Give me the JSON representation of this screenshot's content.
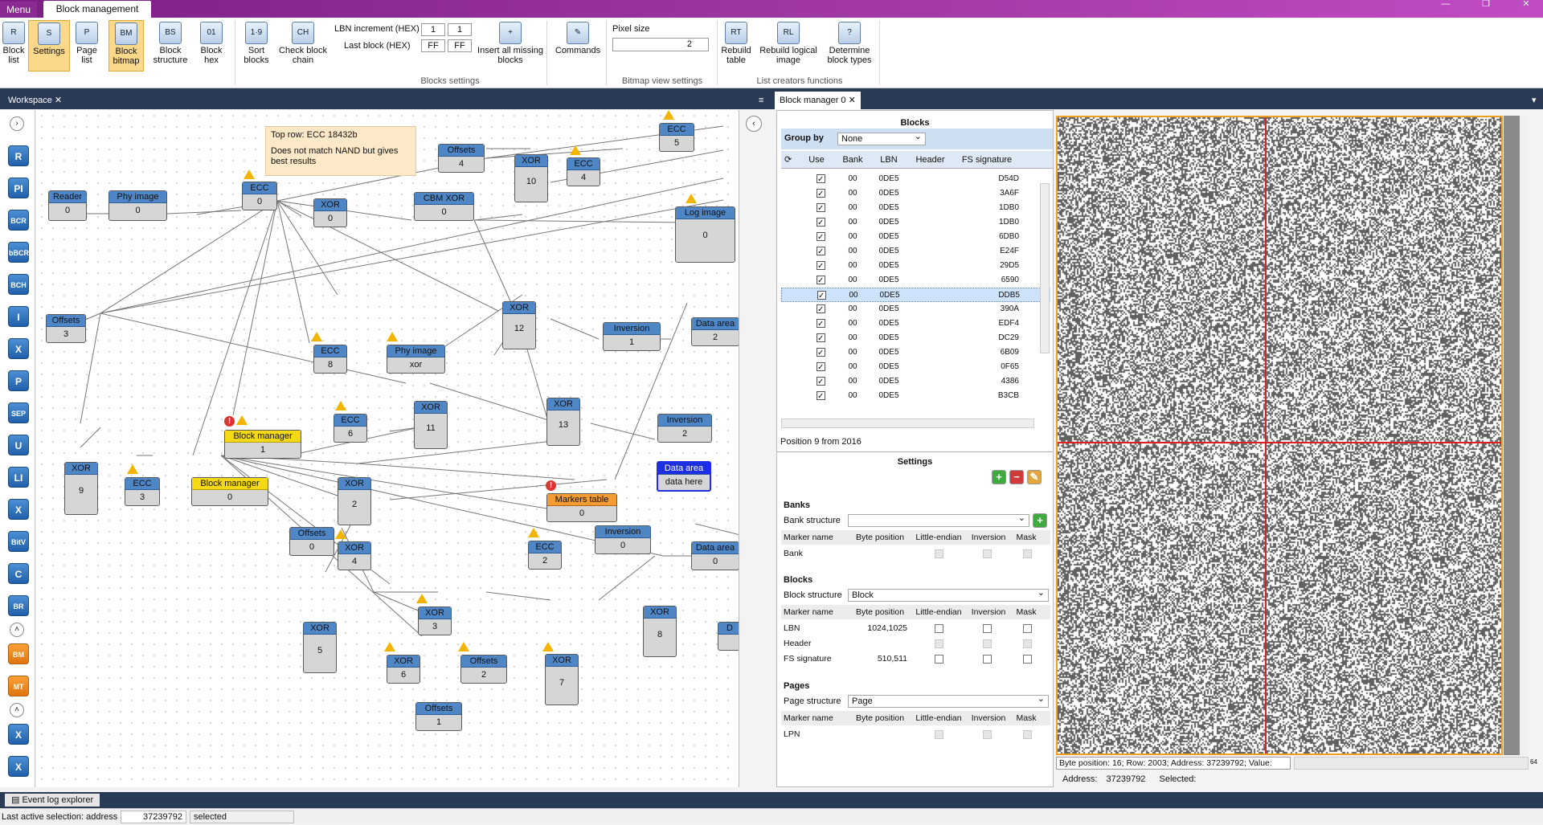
{
  "window": {
    "menu_label": "Menu",
    "active_tab": "Block management"
  },
  "ribbon": {
    "buttons": [
      {
        "label": "Block list",
        "icon": "R"
      },
      {
        "label": "Settings",
        "icon": "S"
      },
      {
        "label": "Page list",
        "icon": "P"
      },
      {
        "label": "Block bitmap",
        "icon": "BM"
      },
      {
        "label": "Block structure",
        "icon": "BS"
      },
      {
        "label": "Block hex",
        "icon": "01"
      },
      {
        "label": "Sort blocks",
        "icon": "1·9"
      },
      {
        "label": "Check block chain",
        "icon": "CH"
      },
      {
        "label": "Insert all missing blocks",
        "icon": "+"
      },
      {
        "label": "Commands",
        "icon": "✎"
      },
      {
        "label": "Rebuild table",
        "icon": "RT"
      },
      {
        "label": "Rebuild logical image",
        "icon": "RL"
      },
      {
        "label": "Determine block types",
        "icon": "?"
      }
    ],
    "lbn_increment_label": "LBN increment (HEX)",
    "lbn_increment": [
      "1",
      "1"
    ],
    "last_block_label": "Last block (HEX)",
    "last_block": [
      "FF",
      "FF"
    ],
    "pixel_size_label": "Pixel size",
    "pixel_size": "2",
    "groups": [
      "Blocks settings",
      "Bitmap view settings",
      "List creators functions"
    ]
  },
  "docbar": {
    "workspace_tab": "Workspace",
    "manager_tab": "Block manager 0"
  },
  "left_tools": [
    "R",
    "PI",
    "BCR",
    "bBCR",
    "BCH",
    "I",
    "X",
    "P",
    "SEP",
    "U",
    "LI",
    "X",
    "BitV",
    "C",
    "BR",
    "BM",
    "MT",
    "X",
    "X"
  ],
  "canvas": {
    "note": {
      "line1": "Top row: ECC 18432b",
      "line2": "Does not match NAND but gives best results"
    },
    "nodes": [
      {
        "title": "Reader",
        "value": "0"
      },
      {
        "title": "Phy image",
        "value": "0"
      },
      {
        "title": "ECC",
        "value": "0"
      },
      {
        "title": "XOR",
        "value": "0"
      },
      {
        "title": "CBM XOR",
        "value": "0"
      },
      {
        "title": "Offsets",
        "value": "4"
      },
      {
        "title": "XOR",
        "value": "10"
      },
      {
        "title": "ECC",
        "value": "4"
      },
      {
        "title": "ECC",
        "value": "5"
      },
      {
        "title": "Log image",
        "value": "0"
      },
      {
        "title": "Offsets",
        "value": "3"
      },
      {
        "title": "ECC",
        "value": "8"
      },
      {
        "title": "Phy image",
        "value": "xor"
      },
      {
        "title": "XOR",
        "value": "12"
      },
      {
        "title": "Inversion",
        "value": "1"
      },
      {
        "title": "Data area",
        "value": "2"
      },
      {
        "title": "ECC",
        "value": "6"
      },
      {
        "title": "XOR",
        "value": "11"
      },
      {
        "title": "XOR",
        "value": "13"
      },
      {
        "title": "Inversion",
        "value": "2"
      },
      {
        "title": "Block manager",
        "value": "1"
      },
      {
        "title": "XOR",
        "value": "9"
      },
      {
        "title": "ECC",
        "value": "3"
      },
      {
        "title": "Block manager",
        "value": "0"
      },
      {
        "title": "XOR",
        "value": "2"
      },
      {
        "title": "Markers table",
        "value": "0"
      },
      {
        "title": "Data area",
        "value": "data here"
      },
      {
        "title": "Offsets",
        "value": "0"
      },
      {
        "title": "XOR",
        "value": "4"
      },
      {
        "title": "ECC",
        "value": "2"
      },
      {
        "title": "Inversion",
        "value": "0"
      },
      {
        "title": "Data area",
        "value": "0"
      },
      {
        "title": "XOR",
        "value": "3"
      },
      {
        "title": "XOR",
        "value": "8"
      },
      {
        "title": "D",
        "value": ""
      },
      {
        "title": "XOR",
        "value": "5"
      },
      {
        "title": "XOR",
        "value": "6"
      },
      {
        "title": "Offsets",
        "value": "2"
      },
      {
        "title": "XOR",
        "value": "7"
      },
      {
        "title": "Offsets",
        "value": "1"
      }
    ]
  },
  "blocks_panel": {
    "title": "Blocks",
    "group_by_label": "Group by",
    "group_by_value": "None",
    "columns": [
      "Use",
      "Bank",
      "LBN",
      "Header",
      "FS signature"
    ],
    "rows": [
      {
        "bank": "00",
        "lbn": "0DE5",
        "fs": "D54D"
      },
      {
        "bank": "00",
        "lbn": "0DE5",
        "fs": "3A6F"
      },
      {
        "bank": "00",
        "lbn": "0DE5",
        "fs": "1DB0"
      },
      {
        "bank": "00",
        "lbn": "0DE5",
        "fs": "1DB0"
      },
      {
        "bank": "00",
        "lbn": "0DE5",
        "fs": "6DB0"
      },
      {
        "bank": "00",
        "lbn": "0DE5",
        "fs": "E24F"
      },
      {
        "bank": "00",
        "lbn": "0DE5",
        "fs": "29D5"
      },
      {
        "bank": "00",
        "lbn": "0DE5",
        "fs": "6590"
      },
      {
        "bank": "00",
        "lbn": "0DE5",
        "fs": "DDB5"
      },
      {
        "bank": "00",
        "lbn": "0DE5",
        "fs": "390A"
      },
      {
        "bank": "00",
        "lbn": "0DE5",
        "fs": "EDF4"
      },
      {
        "bank": "00",
        "lbn": "0DE5",
        "fs": "DC29"
      },
      {
        "bank": "00",
        "lbn": "0DE5",
        "fs": "6B09"
      },
      {
        "bank": "00",
        "lbn": "0DE5",
        "fs": "0F65"
      },
      {
        "bank": "00",
        "lbn": "0DE5",
        "fs": "4386"
      },
      {
        "bank": "00",
        "lbn": "0DE5",
        "fs": "B3CB"
      }
    ],
    "position_text": "Position 9 from 2016"
  },
  "settings_panel": {
    "title": "Settings",
    "banks_label": "Banks",
    "bank_structure_label": "Bank structure",
    "bank_structure_value": "",
    "table_headers": [
      "Marker name",
      "Byte position",
      "Little-endian",
      "Inversion",
      "Mask"
    ],
    "bank_rows": [
      {
        "name": "Bank",
        "pos": ""
      }
    ],
    "blocks_label": "Blocks",
    "block_structure_label": "Block structure",
    "block_structure_value": "Block",
    "block_rows": [
      {
        "name": "LBN",
        "pos": "1024,1025"
      },
      {
        "name": "Header",
        "pos": ""
      },
      {
        "name": "FS signature",
        "pos": "510,511"
      }
    ],
    "pages_label": "Pages",
    "page_structure_label": "Page structure",
    "page_structure_value": "Page",
    "page_rows": [
      {
        "name": "LPN",
        "pos": ""
      }
    ]
  },
  "bitmap": {
    "status": "Byte position: 16; Row: 2003; Address: 37239792; Value:",
    "address_label": "Address:",
    "address_value": "37239792",
    "selected_label": "Selected:",
    "zoom": "64"
  },
  "bottom": {
    "event_log_tab": "Event log explorer"
  },
  "status": {
    "label": "Last active selection:  address",
    "address": "37239792",
    "selected": "selected"
  },
  "colors": {
    "accent": "#8a2a92",
    "node_header": "#4f86c6",
    "warning": "#f3b500",
    "selection_line": "#e02020"
  }
}
